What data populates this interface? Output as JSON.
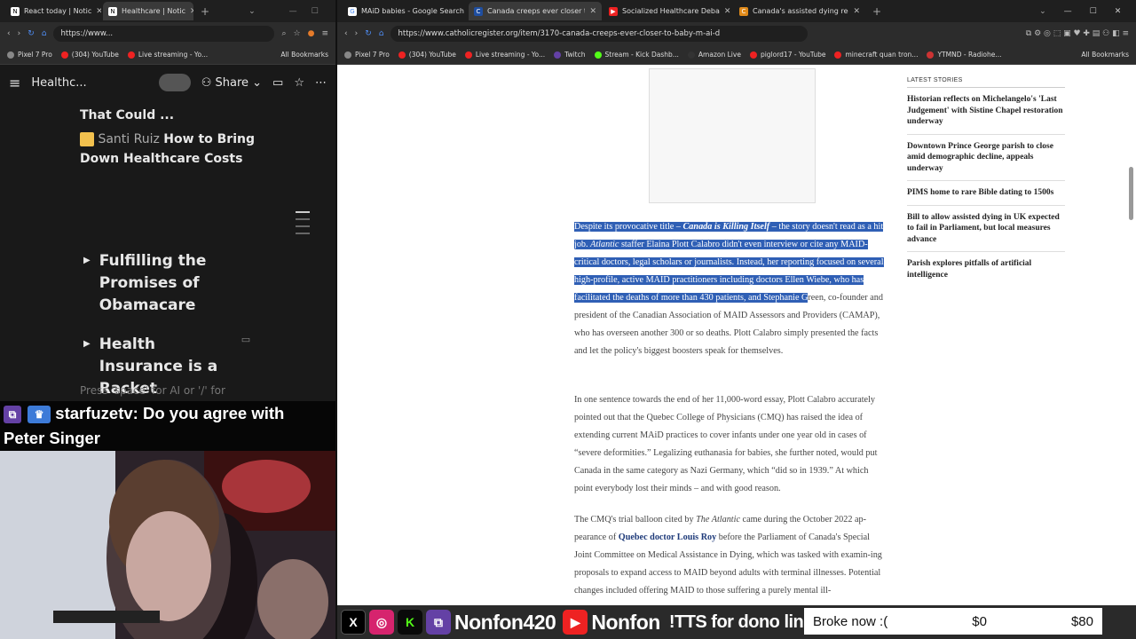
{
  "left_browser": {
    "tabs": [
      {
        "title": "React today | Notic",
        "active": false
      },
      {
        "title": "Healthcare | Notic",
        "active": true
      }
    ],
    "url": "https://www...",
    "bookmarks": [
      "Pixel 7 Pro",
      "(304) YouTube",
      "Live streaming - Yo..."
    ],
    "all_bookmarks": "All Bookmarks",
    "notion": {
      "page_title": "Healthc...",
      "share_label": "Share",
      "partial_title": "That Could ...",
      "author": "Santi Ruiz",
      "link_title": "How to Bring Down Healthcare Costs",
      "toggle1": "Fulfilling the Promises of Obamacare",
      "toggle2": "Health Insurance is a Racket",
      "hint": "Press 'space' for AI or '/' for"
    }
  },
  "chat": {
    "username": "starfuzetv:",
    "message_part1": "Do you agree with",
    "message_part2": "Peter Singer"
  },
  "right_browser": {
    "tabs": [
      {
        "title": "MAiD babies - Google Search",
        "active": false
      },
      {
        "title": "Canada creeps ever closer to b",
        "active": true
      },
      {
        "title": "Socialized Healthcare Deba",
        "active": false
      },
      {
        "title": "Canada's assisted dying regime",
        "active": false
      }
    ],
    "url": "https://www.catholicregister.org/item/3170-canada-creeps-ever-closer-to-baby-m-ai-d",
    "bookmarks": [
      "Pixel 7 Pro",
      "(304) YouTube",
      "Live streaming - Yo...",
      "Twitch",
      "Stream - Kick Dashb...",
      "Amazon Live",
      "piglord17 - YouTube",
      "minecraft quan tron...",
      "YTMND - Radiohe..."
    ],
    "all_bookmarks": "All Bookmarks",
    "sidebar": {
      "header": "LATEST STORIES",
      "stories": [
        "Historian reflects on Michelangelo's 'Last Judgement' with Sistine Chapel restoration underway",
        "Downtown Prince George parish to close amid demographic decline, appeals underway",
        "PIMS home to rare Bible dating to 1500s",
        "Bill to allow assisted dying in UK expected to fail in Parliament, but local measures advance",
        "Parish explores pitfalls of artificial intelligence"
      ]
    },
    "article": {
      "p1_sel_1": "Despite its provocative title – ",
      "p1_sel_title": "Canada is Killing Itself",
      "p1_sel_2": " – the story doesn't read as a hit job. ",
      "p1_sel_atlantic": "Atlantic",
      "p1_sel_3": " staffer Elaina Plott Calabro didn't even interview or cite any MAID-critical doctors, legal scholars or journalists. Instead, her reporting focused on several high-profile, active MAID practitioners including doctors Ellen Wiebe, who has facilitated the deaths of more than 430 patients, and Stephanie G",
      "p1_rest": "reen, co-founder and president of the Canadian Association of MAID Assessors and Providers (CAMAP), who has overseen another 300 or so deaths. Plott Calabro simply presented the facts and let the policy's biggest boosters speak for themselves.",
      "p2": "In one sentence towards the end of her 11,000-word essay, Plott Calabro accurately pointed out that the Quebec College of Physicians (CMQ) has raised the idea of extending current MAiD practices to cover infants under one year old in cases of “severe deformities.” Legalizing euthanasia for babies, she further noted, would put Canada in the same category as Nazi Germany, which “did so in 1939.” At which point everybody lost their minds – and with good reason.",
      "p3_1": "The CMQ's trial balloon cited by ",
      "p3_atlantic": "The Atlantic",
      "p3_2": " came during the October 2022 ap-pearance of ",
      "p3_link": "Quebec doctor Louis Roy",
      "p3_3": " before the Parliament of Canada's Special Joint Committee on Medical Assistance in Dying, which was tasked with examin-ing proposals to expand access to MAID beyond adults with terminal illnesses. Potential changes included offering MAID to those suffering a purely mental ill-"
    }
  },
  "overlay": {
    "handle1": "Nonfon420",
    "handle2": "Nonfon",
    "tts": "!TTS for dono link",
    "goal_label": "Broke now :(",
    "goal_current": "$0",
    "goal_target": "$80"
  }
}
